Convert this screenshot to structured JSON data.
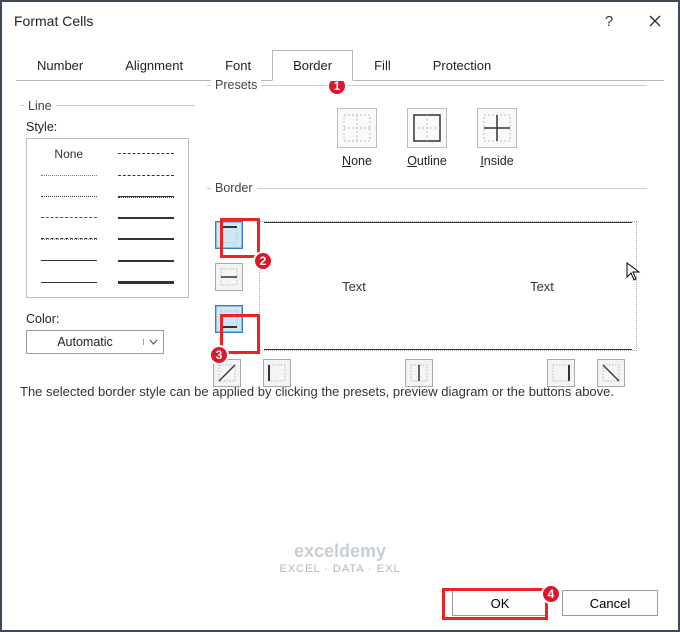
{
  "title": "Format Cells",
  "tabs": [
    "Number",
    "Alignment",
    "Font",
    "Border",
    "Fill",
    "Protection"
  ],
  "active_tab": "Border",
  "line": {
    "section": "Line",
    "style_label": "Style:",
    "none": "None",
    "color_label": "Color:",
    "color_value": "Automatic"
  },
  "presets": {
    "section": "Presets",
    "items": [
      {
        "label": "None",
        "accel": "N"
      },
      {
        "label": "Outline",
        "accel": "O"
      },
      {
        "label": "Inside",
        "accel": "I"
      }
    ]
  },
  "border": {
    "section": "Border",
    "preview_text1": "Text",
    "preview_text2": "Text"
  },
  "hint": "The selected border style can be applied by clicking the presets, preview diagram or the buttons above.",
  "buttons": {
    "ok": "OK",
    "cancel": "Cancel"
  },
  "watermark": {
    "brand": "exceldemy",
    "tag": "EXCEL · DATA · EXL"
  },
  "annotations": [
    1,
    2,
    3,
    4
  ]
}
